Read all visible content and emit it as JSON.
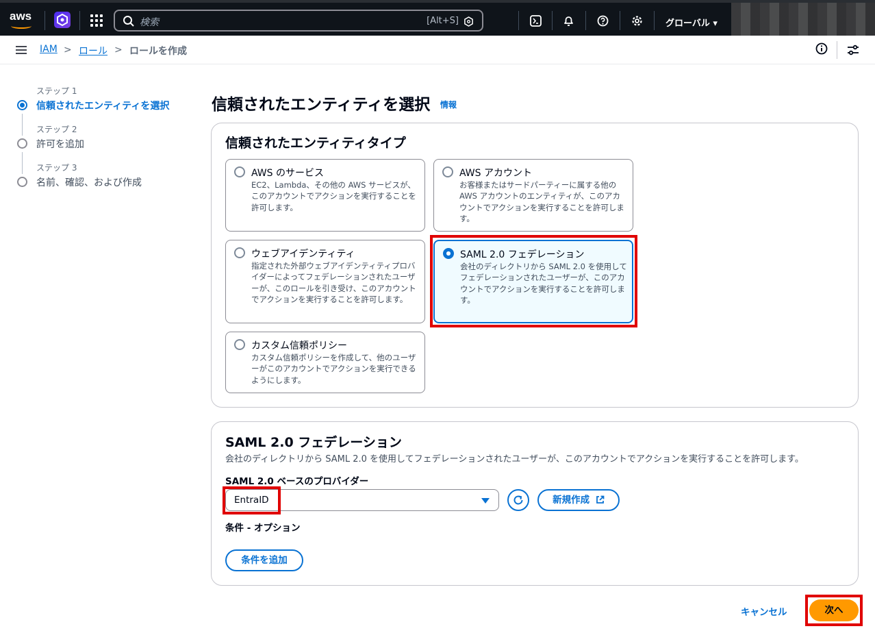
{
  "topbar": {
    "logo_text": "aws",
    "search_placeholder": "検索",
    "search_shortcut": "[Alt+S]",
    "region": "グローバル ▾",
    "icons": [
      "aws-logo",
      "app-icon",
      "services-grid-icon",
      "search-icon",
      "cloudshell-icon",
      "bell-icon",
      "help-icon",
      "gear-icon"
    ]
  },
  "breadcrumb": {
    "items": [
      "IAM",
      "ロール",
      "ロールを作成"
    ]
  },
  "steps": [
    {
      "small": "ステップ 1",
      "label": "信頼されたエンティティを選択",
      "active": true
    },
    {
      "small": "ステップ 2",
      "label": "許可を追加",
      "active": false
    },
    {
      "small": "ステップ 3",
      "label": "名前、確認、および作成",
      "active": false
    }
  ],
  "main": {
    "title": "信頼されたエンティティを選択",
    "info": "情報",
    "entity_section": {
      "heading": "信頼されたエンティティタイプ",
      "options": [
        {
          "title": "AWS のサービス",
          "desc": "EC2、Lambda、その他の AWS サービスが、このアカウントでアクションを実行することを許可します。",
          "selected": false
        },
        {
          "title": "AWS アカウント",
          "desc": "お客様またはサードパーティーに属する他の AWS アカウントのエンティティが、このアカウントでアクションを実行することを許可します。",
          "selected": false
        },
        {
          "title": "ウェブアイデンティティ",
          "desc": "指定された外部ウェブアイデンティティプロバイダーによってフェデレーションされたユーザーが、このロールを引き受け、このアカウントでアクションを実行することを許可します。",
          "selected": false
        },
        {
          "title": "SAML 2.0 フェデレーション",
          "desc": "会社のディレクトリから SAML 2.0 を使用してフェデレーションされたユーザーが、このアカウントでアクションを実行することを許可します。",
          "selected": true
        },
        {
          "title": "カスタム信頼ポリシー",
          "desc": "カスタム信頼ポリシーを作成して、他のユーザーがこのアカウントでアクションを実行できるようにします。",
          "selected": false
        }
      ]
    },
    "saml_section": {
      "heading": "SAML 2.0 フェデレーション",
      "desc": "会社のディレクトリから SAML 2.0 を使用してフェデレーションされたユーザーが、このアカウントでアクションを実行することを許可します。",
      "provider_label": "SAML 2.0 ベースのプロバイダー",
      "provider_value": "EntraID",
      "create_new": "新規作成",
      "conditions_label": "条件 - オプション",
      "add_condition": "条件を追加"
    },
    "footer": {
      "cancel": "キャンセル",
      "next": "次へ"
    }
  },
  "colors": {
    "accent": "#0972d3",
    "primary_button": "#ff9900",
    "highlight": "#e00000"
  }
}
